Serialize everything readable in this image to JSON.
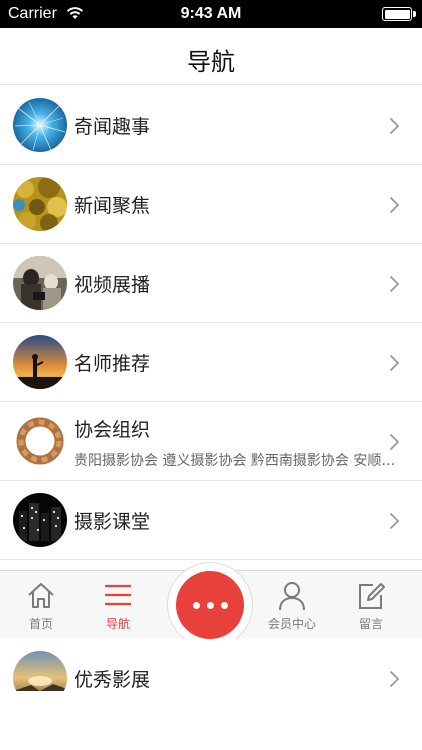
{
  "status_bar": {
    "carrier": "Carrier",
    "time": "9:43 AM"
  },
  "header": {
    "title": "导航"
  },
  "list": [
    {
      "title": "奇闻趣事",
      "icon": "abstract-blue-thumbnail"
    },
    {
      "title": "新闻聚焦",
      "icon": "golden-leaves-thumbnail"
    },
    {
      "title": "视频展播",
      "icon": "people-photo-thumbnail"
    },
    {
      "title": "名师推荐",
      "icon": "sunset-photographer-thumbnail"
    },
    {
      "title": "协会组织",
      "subtitle": "贵阳摄影协会   遵义摄影协会   黔西南摄影协会   安顺摄影协会",
      "icon": "bread-ring-thumbnail"
    },
    {
      "title": "摄影课堂",
      "icon": "night-city-thumbnail"
    }
  ],
  "tabs": [
    {
      "label": "首页",
      "icon": "home-icon"
    },
    {
      "label": "导航",
      "icon": "menu-icon",
      "active": true
    },
    {
      "label": "",
      "icon": "more-icon"
    },
    {
      "label": "会员中心",
      "icon": "user-icon"
    },
    {
      "label": "留言",
      "icon": "edit-icon"
    }
  ],
  "partial_row": {
    "title": "优秀影展",
    "icon": "landscape-thumbnail"
  },
  "colors": {
    "accent": "#e8403a",
    "tab_inactive": "#7a7a7a",
    "divider": "#e6e6e6"
  }
}
